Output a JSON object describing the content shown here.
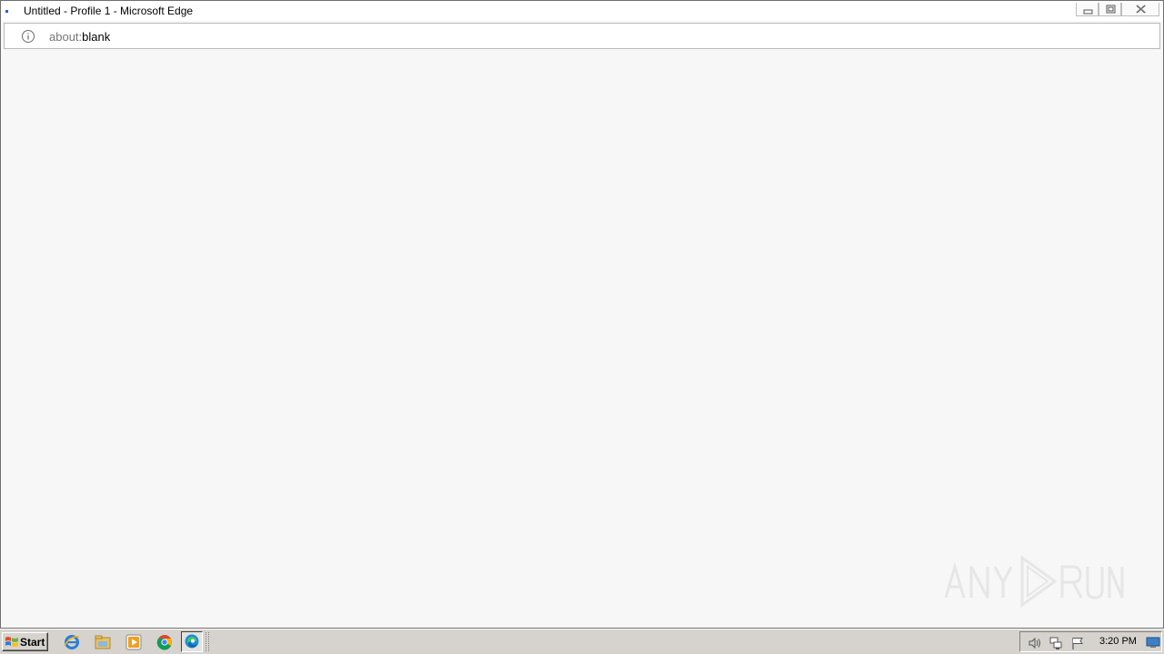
{
  "window": {
    "title": "Untitled - Profile 1 - Microsoft Edge",
    "buttons": {
      "minimize_icon": "minimize-icon",
      "maximize_icon": "restore-icon",
      "close_icon": "close-icon"
    }
  },
  "address_bar": {
    "info_icon": "info-icon",
    "url_scheme": "about:",
    "url_rest": "blank"
  },
  "content": {
    "watermark_logo": "ANY RUN"
  },
  "taskbar": {
    "start_label": "Start",
    "pinned_icons": [
      "internet-explorer-icon",
      "file-explorer-icon",
      "media-player-icon",
      "chrome-icon",
      "edge-icon"
    ],
    "active_app": "edge-icon",
    "tray_icons": [
      "volume-icon",
      "network-icon",
      "action-center-flag-icon"
    ],
    "clock": "3:20 PM",
    "show_desktop_icon": "show-desktop-icon"
  },
  "colors": {
    "page_background": "#f7f7f7",
    "taskbar_background": "#d6d3ce",
    "url_scheme_gray": "#767676"
  }
}
